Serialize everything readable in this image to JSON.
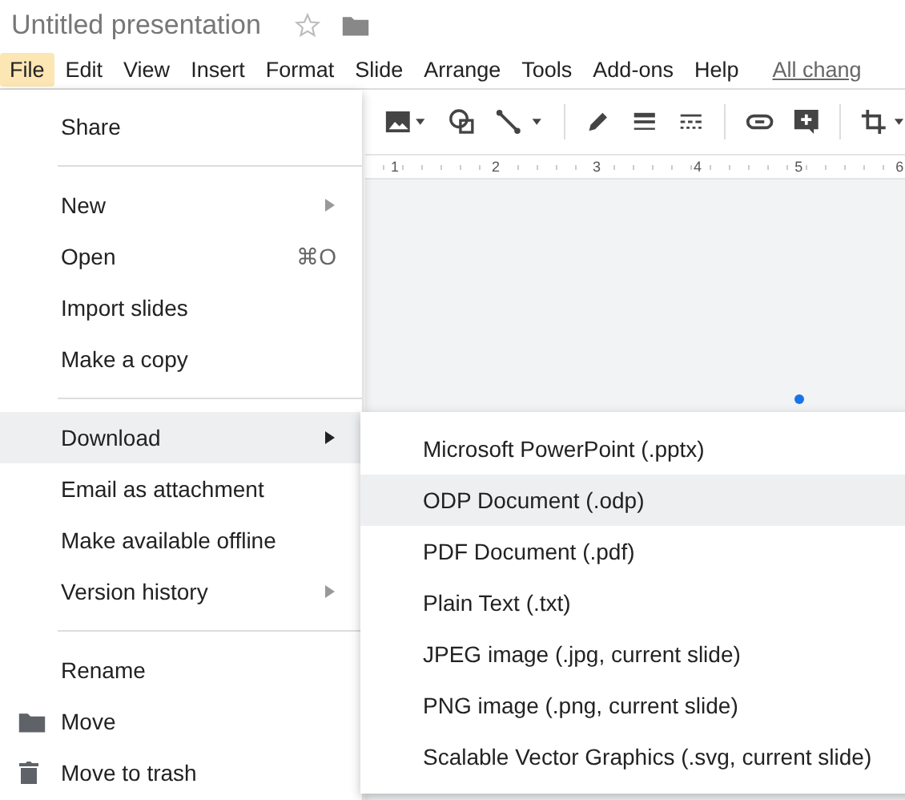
{
  "document": {
    "title": "Untitled presentation"
  },
  "menubar": [
    {
      "label": "File",
      "selected": true
    },
    {
      "label": "Edit",
      "selected": false
    },
    {
      "label": "View",
      "selected": false
    },
    {
      "label": "Insert",
      "selected": false
    },
    {
      "label": "Format",
      "selected": false
    },
    {
      "label": "Slide",
      "selected": false
    },
    {
      "label": "Arrange",
      "selected": false
    },
    {
      "label": "Tools",
      "selected": false
    },
    {
      "label": "Add-ons",
      "selected": false
    },
    {
      "label": "Help",
      "selected": false
    }
  ],
  "save_status": "All chang",
  "ruler": [
    "1",
    "2",
    "3",
    "4",
    "5",
    "6"
  ],
  "file_menu": {
    "sections": [
      [
        {
          "label": "Share",
          "selected": false
        }
      ],
      [
        {
          "label": "New",
          "submenu": true,
          "selected": false
        },
        {
          "label": "Open",
          "shortcut": "⌘O",
          "selected": false
        },
        {
          "label": "Import slides",
          "selected": false
        },
        {
          "label": "Make a copy",
          "selected": false
        }
      ],
      [
        {
          "label": "Download",
          "submenu": true,
          "selected": true
        },
        {
          "label": "Email as attachment",
          "selected": false
        },
        {
          "label": "Make available offline",
          "selected": false
        },
        {
          "label": "Version history",
          "submenu": true,
          "selected": false
        }
      ],
      [
        {
          "label": "Rename",
          "selected": false
        },
        {
          "label": "Move",
          "kind": "folder",
          "selected": false
        },
        {
          "label": "Move to trash",
          "kind": "trash",
          "selected": false
        }
      ]
    ]
  },
  "download_menu": [
    {
      "label": "Microsoft PowerPoint (.pptx)",
      "selected": false
    },
    {
      "label": "ODP Document (.odp)",
      "selected": true
    },
    {
      "label": "PDF Document (.pdf)",
      "selected": false
    },
    {
      "label": "Plain Text (.txt)",
      "selected": false
    },
    {
      "label": "JPEG image (.jpg, current slide)",
      "selected": false
    },
    {
      "label": "PNG image (.png, current slide)",
      "selected": false
    },
    {
      "label": "Scalable Vector Graphics (.svg, current slide)",
      "selected": false
    }
  ]
}
